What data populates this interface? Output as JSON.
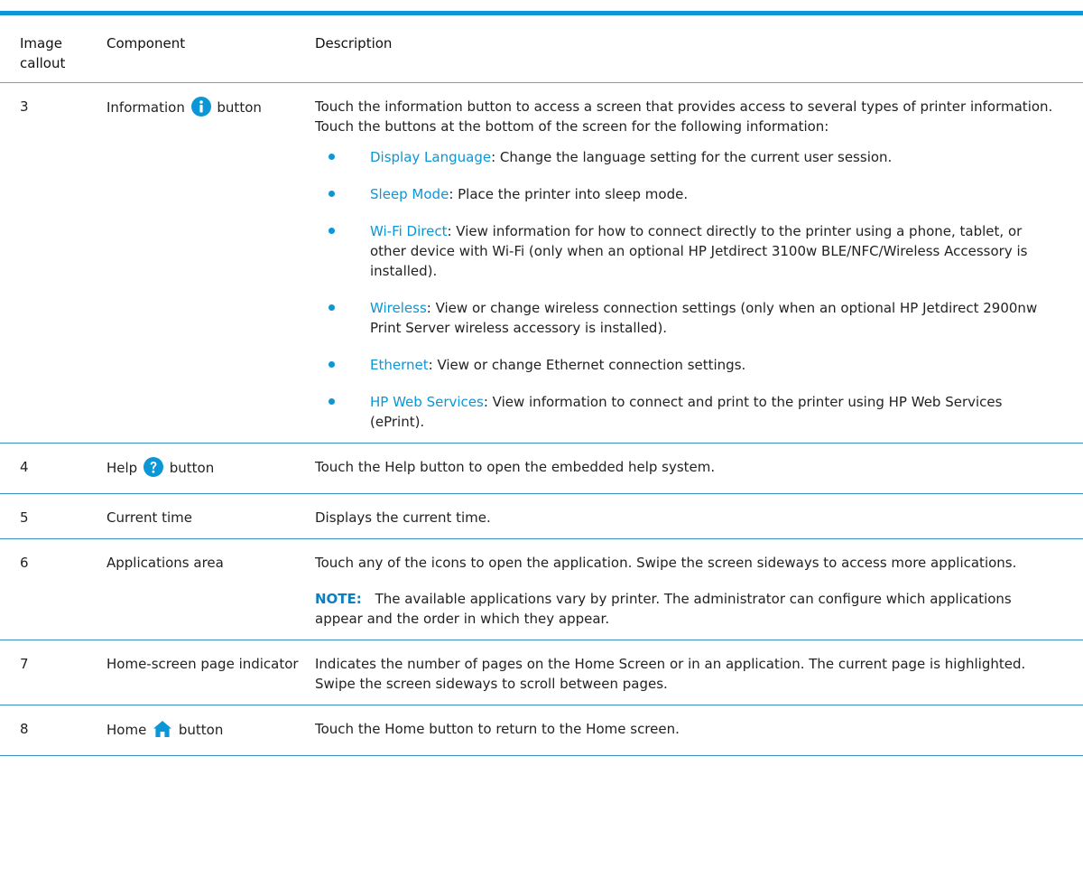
{
  "header_cols": {
    "callout": "Image callout",
    "component": "Component",
    "description": "Description"
  },
  "rows": [
    {
      "callout": "3",
      "component_pre": "Information",
      "component_post": "button",
      "icon": "information-icon",
      "intro": "Touch the information button to access a screen that provides access to several types of printer information. Touch the buttons at the bottom of the screen for the following information:",
      "bullets": [
        {
          "term": "Display Language",
          "text": ": Change the language setting for the current user session."
        },
        {
          "term": "Sleep Mode",
          "text": ": Place the printer into sleep mode."
        },
        {
          "term": "Wi-Fi Direct",
          "text": ": View information for how to connect directly to the printer using a phone, tablet, or other device with Wi-Fi (only when an optional HP Jetdirect 3100w BLE/NFC/Wireless Accessory is installed)."
        },
        {
          "term": "Wireless",
          "text": ": View or change wireless connection settings (only when an optional HP Jetdirect 2900nw Print Server wireless accessory is installed)."
        },
        {
          "term": "Ethernet",
          "text": ": View or change Ethernet connection settings."
        },
        {
          "term": "HP Web Services",
          "text": ": View information to connect and print to the printer using HP Web Services (ePrint)."
        }
      ]
    },
    {
      "callout": "4",
      "component_pre": "Help",
      "component_post": "button",
      "icon": "help-icon",
      "desc": "Touch the Help button to open the embedded help system."
    },
    {
      "callout": "5",
      "component": "Current time",
      "desc": "Displays the current time."
    },
    {
      "callout": "6",
      "component": "Applications area",
      "desc": "Touch any of the icons to open the application. Swipe the screen sideways to access more applications.",
      "note_label": "NOTE:",
      "note_text": "The available applications vary by printer. The administrator can configure which applications appear and the order in which they appear."
    },
    {
      "callout": "7",
      "component": "Home-screen page indicator",
      "desc": "Indicates the number of pages on the Home Screen or in an application. The current page is highlighted. Swipe the screen sideways to scroll between pages."
    },
    {
      "callout": "8",
      "component_pre": "Home",
      "component_post": "button",
      "icon": "home-icon",
      "desc": "Touch the Home button to return to the Home screen."
    }
  ],
  "colors": {
    "accent": "#0b96d6",
    "rule": "#3a8fc2"
  }
}
